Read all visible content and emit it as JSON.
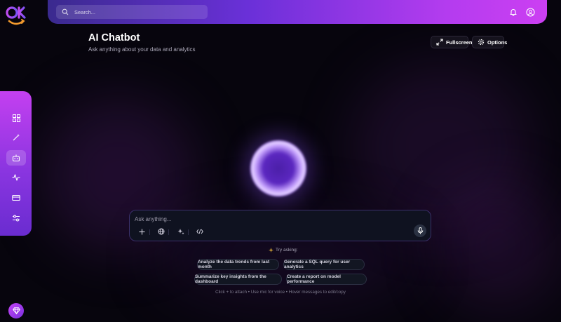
{
  "app": {
    "logo_text": "OK",
    "accent": "#b43cef"
  },
  "topbar": {
    "search_placeholder": "Search...",
    "icons": [
      "search-icon",
      "bell-icon",
      "user-circle-icon"
    ]
  },
  "sidebar": {
    "items": [
      {
        "icon": "dashboard-icon",
        "active": false
      },
      {
        "icon": "magic-wand-icon",
        "active": false
      },
      {
        "icon": "bot-icon",
        "active": true
      },
      {
        "icon": "activity-icon",
        "active": false
      },
      {
        "icon": "card-icon",
        "active": false
      },
      {
        "icon": "sliders-icon",
        "active": false
      }
    ]
  },
  "page": {
    "title": "AI Chatbot",
    "subtitle": "Ask anything about your data and analytics"
  },
  "header_actions": {
    "fullscreen_label": "Fullscreen",
    "options_label": "Options"
  },
  "chat": {
    "placeholder": "Ask anything...",
    "tools": [
      "plus-icon",
      "globe-icon",
      "sparkles-icon",
      "code-icon"
    ],
    "mic_icon": "mic-icon"
  },
  "suggestions": {
    "heading": "Try asking:",
    "items": [
      "Analyze the data trends from last month",
      "Generate a SQL query for user analytics",
      "Summarize key insights from the dashboard",
      "Create a report on model performance"
    ]
  },
  "hint": "Click + to attach • Use mic for voice • Hover messages to edit/copy",
  "footer": {
    "pro_icon": "diamond-icon"
  }
}
